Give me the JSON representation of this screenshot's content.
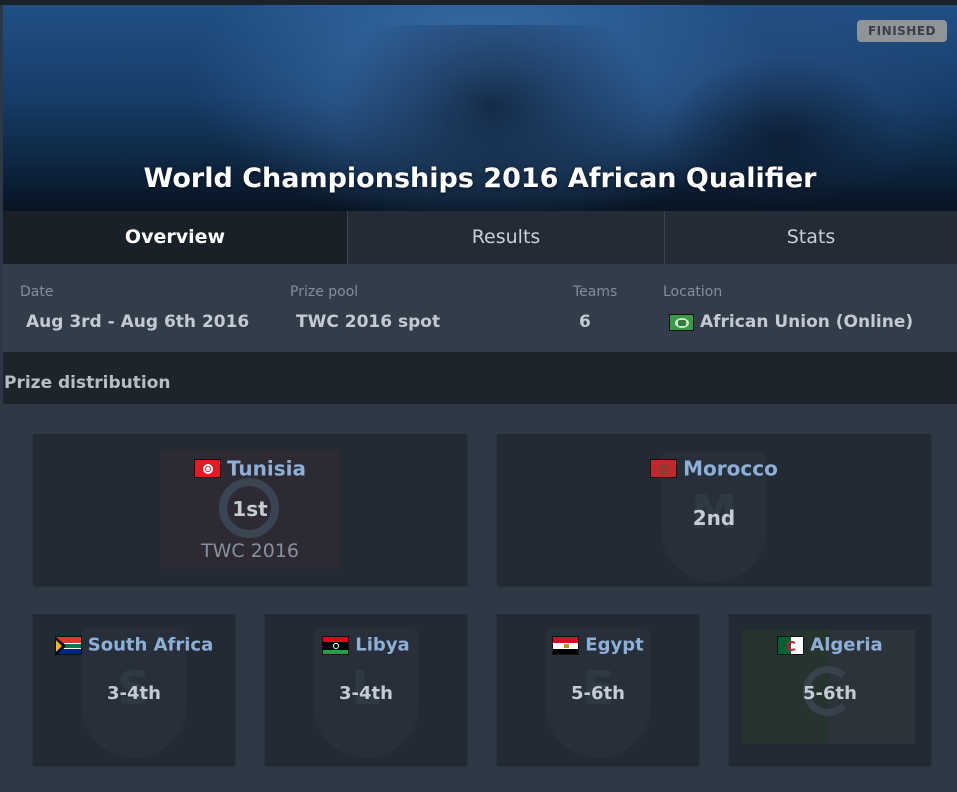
{
  "header": {
    "title": "World Championships 2016 African Qualifier",
    "status_badge": "FINISHED"
  },
  "tabs": [
    {
      "label": "Overview",
      "active": true
    },
    {
      "label": "Results",
      "active": false
    },
    {
      "label": "Stats",
      "active": false
    }
  ],
  "info": {
    "date_label": "Date",
    "date_value": "Aug 3rd - Aug 6th 2016",
    "prize_label": "Prize pool",
    "prize_value": "TWC 2016 spot",
    "teams_label": "Teams",
    "teams_value": "6",
    "location_label": "Location",
    "location_value": "African Union (Online)",
    "location_flag_icon": "african-union-flag-icon"
  },
  "prize_distribution": {
    "title": "Prize distribution",
    "placements": [
      {
        "team": "Tunisia",
        "place": "1st",
        "prize": "TWC 2016",
        "flag_icon": "tunisia-flag-icon",
        "logo_letter": ""
      },
      {
        "team": "Morocco",
        "place": "2nd",
        "prize": "",
        "flag_icon": "morocco-flag-icon",
        "logo_letter": "M"
      },
      {
        "team": "South Africa",
        "place": "3-4th",
        "prize": "",
        "flag_icon": "south-africa-flag-icon",
        "logo_letter": "S"
      },
      {
        "team": "Libya",
        "place": "3-4th",
        "prize": "",
        "flag_icon": "libya-flag-icon",
        "logo_letter": "L"
      },
      {
        "team": "Egypt",
        "place": "5-6th",
        "prize": "",
        "flag_icon": "egypt-flag-icon",
        "logo_letter": "E"
      },
      {
        "team": "Algeria",
        "place": "5-6th",
        "prize": "",
        "flag_icon": "algeria-flag-icon",
        "logo_letter": ""
      }
    ]
  },
  "colors": {
    "page_bg": "#2d3844",
    "card_bg": "#222a33",
    "team_name": "#8fb0d6",
    "active_tab_bg": "#1a2027",
    "badge_bg": "#8f9499"
  }
}
